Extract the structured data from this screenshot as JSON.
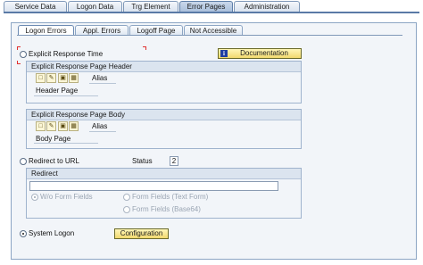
{
  "top_tabs": [
    {
      "label": "Service Data"
    },
    {
      "label": "Logon Data"
    },
    {
      "label": "Trg Element"
    },
    {
      "label": "Error Pages"
    },
    {
      "label": "Administration"
    }
  ],
  "sub_tabs": [
    {
      "label": "Logon Errors"
    },
    {
      "label": "Appl. Errors"
    },
    {
      "label": "Logoff Page"
    },
    {
      "label": "Not Accessible"
    }
  ],
  "explicit_response_time": {
    "label": "Explicit Response Time",
    "selected": false
  },
  "documentation_button": {
    "label": "Documentation",
    "icon": "info-icon"
  },
  "header_group": {
    "title": "Explicit Response Page Header",
    "alias_label": "Alias",
    "field_label": "Header Page"
  },
  "body_group": {
    "title": "Explicit Response Page Body",
    "alias_label": "Alias",
    "field_label": "Body Page"
  },
  "redirect_option": {
    "label": "Redirect to URL",
    "selected": false
  },
  "status": {
    "label": "Status",
    "value": "2"
  },
  "redirect_group": {
    "title": "Redirect",
    "url_value": "",
    "options": [
      {
        "label": "W/o Form Fields",
        "selected": true
      },
      {
        "label": "Form Fields (Text Form)",
        "selected": false
      },
      {
        "label": "Form Fields (Base64)",
        "selected": false
      }
    ]
  },
  "system_logon": {
    "label": "System Logon",
    "selected": true
  },
  "configuration_button": {
    "label": "Configuration"
  },
  "colors": {
    "tab_active": "#a8bedb",
    "button": "#f2d96e",
    "info_icon": "#1f3fa3"
  }
}
